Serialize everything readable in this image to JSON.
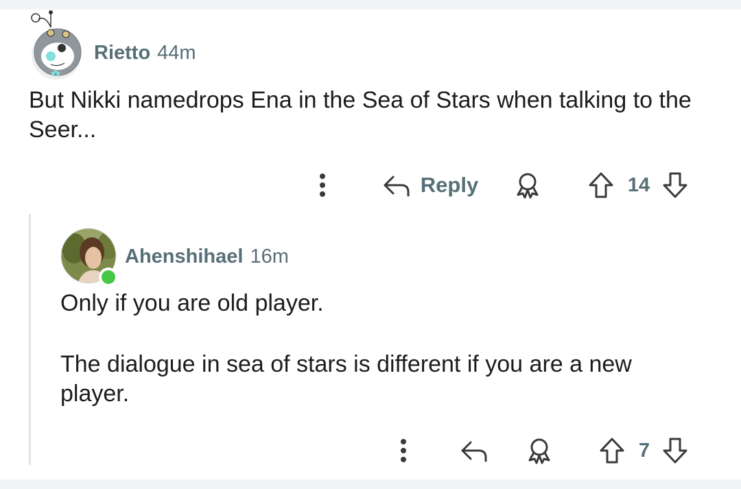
{
  "comments": [
    {
      "author": "Rietto",
      "time": "44m",
      "body": "But Nikki namedrops Ena in the Sea of Stars when talking to the Seer...",
      "actions": {
        "reply_label": "Reply",
        "score": "14"
      }
    },
    {
      "author": "Ahenshihael",
      "time": "16m",
      "body_paragraphs": [
        "Only if you are old player.",
        "The dialogue in sea of stars is different if you are a new player."
      ],
      "online": true,
      "actions": {
        "score": "7"
      }
    }
  ],
  "colors": {
    "meta": "#576f76",
    "text": "#1c1c1c",
    "thread_line": "#e2e4e6",
    "online": "#46c846"
  },
  "icons": {
    "more": "more-vertical-icon",
    "reply": "reply-arrow-icon",
    "award": "award-icon",
    "upvote": "upvote-arrow-icon",
    "downvote": "downvote-arrow-icon"
  }
}
